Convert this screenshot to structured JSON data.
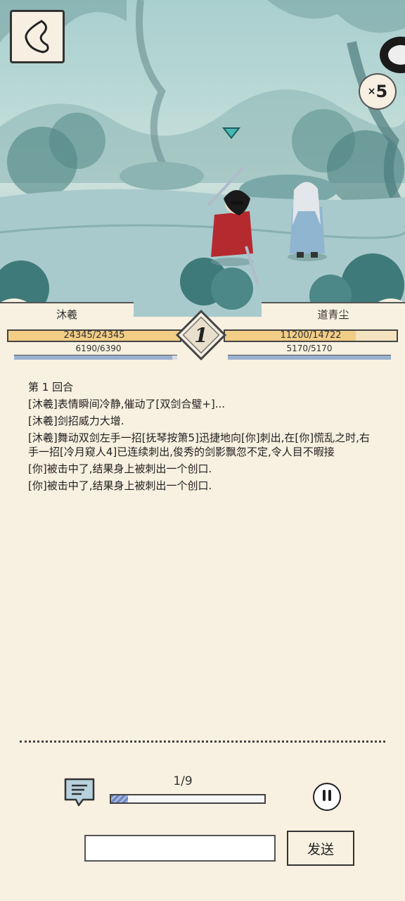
{
  "speed": {
    "prefix": "×",
    "value": "5"
  },
  "players": {
    "left": {
      "name": "沐羲",
      "hp": "24345/24345",
      "hp_fraction": 1.0,
      "mp": "6190/6390",
      "mp_fraction": 0.969
    },
    "right": {
      "name": "道青尘",
      "hp": "11200/14722",
      "hp_fraction": 0.761,
      "mp": "5170/5170",
      "mp_fraction": 1.0
    }
  },
  "round_number": "1",
  "log": [
    "第 1 回合",
    "[沐羲]表情瞬间冷静,催动了[双剑合璧+]...",
    "[沐羲]剑招威力大增.",
    "[沐羲]舞动双剑左手一招[抚琴按箫5]迅捷地向[你]刺出,在[你]慌乱之时,右手一招[冷月窥人4]已连续刺出,俊秀的剑影飘忽不定,令人目不暇接",
    "[你]被击中了,结果身上被刺出一个创口.",
    "[你]被击中了,结果身上被刺出一个创口."
  ],
  "playback": {
    "label": "1/9",
    "fraction": 0.111
  },
  "chat": {
    "placeholder": "",
    "send_label": "发送"
  },
  "icons": {
    "back": "back-arrow-icon",
    "chat": "chat-bubble-icon",
    "pause": "pause-icon",
    "marker": "turn-marker-icon"
  },
  "colors": {
    "background": "#f8f0e0",
    "hp_fill": "#f2cd85",
    "mp_bar": "#9ab0d0",
    "marker": "#46b8b4"
  }
}
